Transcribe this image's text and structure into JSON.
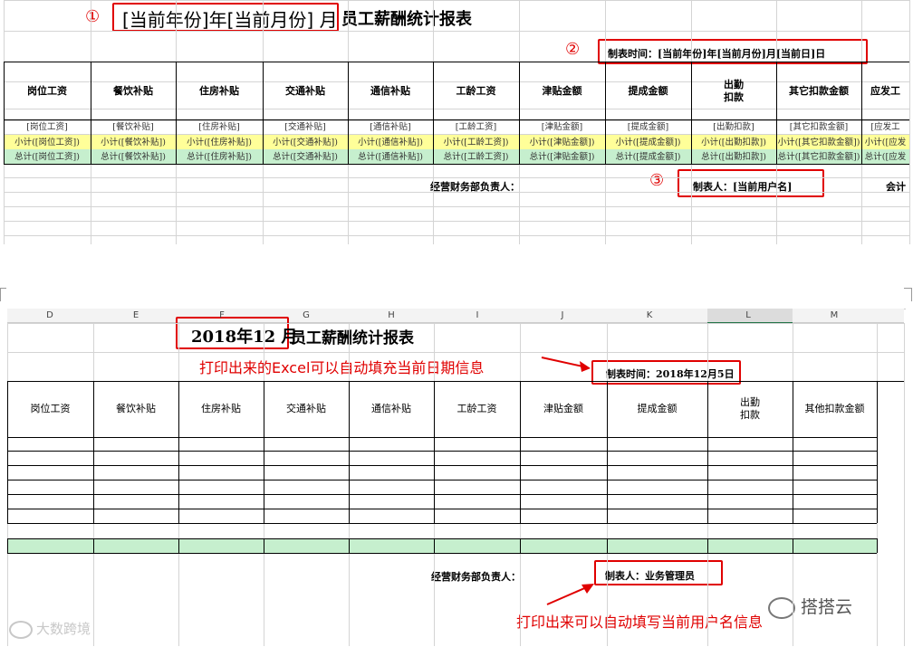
{
  "top": {
    "title_year_month": "[当前年份]年[当前月份] 月",
    "title_suffix": "员工薪酬统计报表",
    "marker1": "①",
    "marker2": "②",
    "marker3": "③",
    "created_time": "制表时间：[当前年份]年[当前月份]月[当前日]日",
    "headers": [
      "岗位工资",
      "餐饮补贴",
      "住房补贴",
      "交通补贴",
      "通信补贴",
      "工龄工资",
      "津贴金额",
      "提成金额",
      "出勤\n扣款",
      "其它扣款金额",
      "应发工"
    ],
    "field_row": [
      "[岗位工资]",
      "[餐饮补贴]",
      "[住房补贴]",
      "[交通补贴]",
      "[通信补贴]",
      "[工龄工资]",
      "[津贴金额]",
      "[提成金额]",
      "[出勤扣款]",
      "[其它扣款金额]",
      "[应发工"
    ],
    "subtotal_row": [
      "小计([岗位工资])",
      "小计([餐饮补贴])",
      "小计([住房补贴])",
      "小计([交通补贴])",
      "小计([通信补贴])",
      "小计([工龄工资])",
      "小计([津贴金额])",
      "小计([提成金额])",
      "小计([出勤扣款])",
      "小计([其它扣款金额])",
      "小计([应发"
    ],
    "total_row": [
      "总计([岗位工资])",
      "总计([餐饮补贴])",
      "总计([住房补贴])",
      "总计([交通补贴])",
      "总计([通信补贴])",
      "总计([工龄工资])",
      "总计([津贴金额])",
      "总计([提成金额])",
      "总计([出勤扣款])",
      "总计([其它扣款金额])",
      "总计([应发"
    ],
    "finance_label": "经营财务部负责人：",
    "creator": "制表人：[当前用户名]",
    "accounting": "会计"
  },
  "bottom": {
    "columns": [
      "D",
      "E",
      "F",
      "G",
      "H",
      "I",
      "J",
      "K",
      "L",
      "M"
    ],
    "title_year_month": "2018年12 月",
    "title_suffix": "员工薪酬统计报表",
    "annotation1": "打印出来的Excel可以自动填充当前日期信息",
    "created_time": "制表时间：2018年12月5日",
    "headers": [
      "岗位工资",
      "餐饮补贴",
      "住房补贴",
      "交通补贴",
      "通信补贴",
      "工龄工资",
      "津贴金额",
      "提成金额",
      "出勤\n扣款",
      "其他扣款金额"
    ],
    "finance_label": "经营财务部负责人：",
    "creator": "制表人：业务管理员",
    "annotation2": "打印出来可以自动填写当前用户名信息"
  },
  "watermarks": {
    "left": "大数跨境",
    "right": "搭搭云"
  },
  "colors": {
    "red": "#e00000",
    "subtotal_yellow": "#ffff99",
    "total_green": "#c6efce",
    "grid": "#d4d4d4"
  }
}
